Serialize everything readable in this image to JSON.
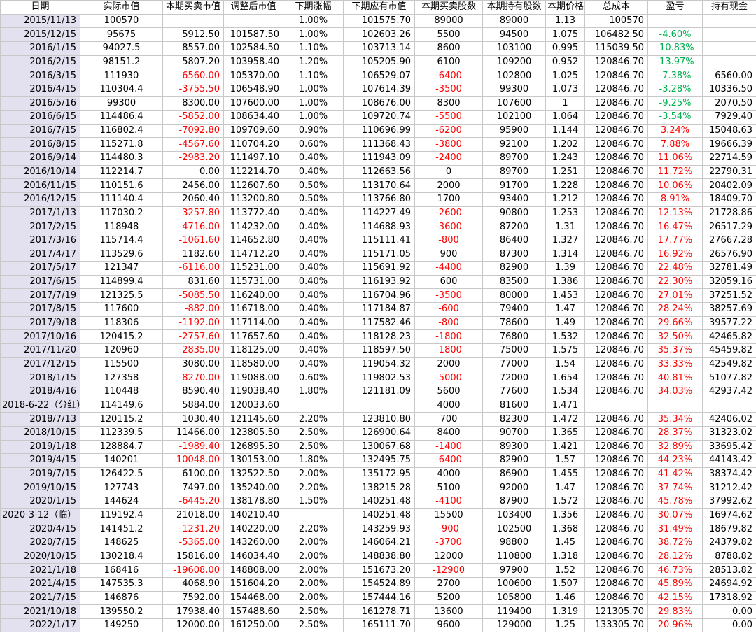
{
  "headers": [
    "日期",
    "实际市值",
    "本期买卖市值",
    "调整后市值",
    "下期涨幅",
    "下期应有市值",
    "本期买卖股数",
    "本期持有股数",
    "本期价格",
    "总成本",
    "盈亏",
    "持有现金"
  ],
  "rows": [
    [
      "2015/11/13",
      "100570",
      "",
      "",
      "1.00%",
      "101575.70",
      "89000",
      "89000",
      "1.13",
      "100570",
      "",
      ""
    ],
    [
      "2015/12/15",
      "95675",
      "5912.50",
      "101587.50",
      "1.00%",
      "102603.26",
      "5500",
      "94500",
      "1.075",
      "106482.50",
      "-4.60%",
      ""
    ],
    [
      "2016/1/15",
      "94027.5",
      "8557.00",
      "102584.50",
      "1.10%",
      "103713.14",
      "8600",
      "103100",
      "0.995",
      "115039.50",
      "-10.83%",
      ""
    ],
    [
      "2016/2/15",
      "98151.2",
      "5807.20",
      "103958.40",
      "1.20%",
      "105205.90",
      "6100",
      "109200",
      "0.952",
      "120846.70",
      "-13.97%",
      ""
    ],
    [
      "2016/3/15",
      "111930",
      "-6560.00",
      "105370.00",
      "1.10%",
      "106529.07",
      "-6400",
      "102800",
      "1.025",
      "120846.70",
      "-7.38%",
      "6560.00"
    ],
    [
      "2016/4/15",
      "110304.4",
      "-3755.50",
      "106548.90",
      "1.00%",
      "107614.39",
      "-3500",
      "99300",
      "1.073",
      "120846.70",
      "-3.28%",
      "10336.50"
    ],
    [
      "2016/5/16",
      "99300",
      "8300.00",
      "107600.00",
      "1.00%",
      "108676.00",
      "8300",
      "107600",
      "1",
      "120846.70",
      "-9.25%",
      "2070.50"
    ],
    [
      "2016/6/15",
      "114486.4",
      "-5852.00",
      "108634.40",
      "1.00%",
      "109720.74",
      "-5500",
      "102100",
      "1.064",
      "120846.70",
      "-3.54%",
      "7929.40"
    ],
    [
      "2016/7/15",
      "116802.4",
      "-7092.80",
      "109709.60",
      "0.90%",
      "110696.99",
      "-6200",
      "95900",
      "1.144",
      "120846.70",
      "3.24%",
      "15048.63"
    ],
    [
      "2016/8/15",
      "115271.8",
      "-4567.60",
      "110704.20",
      "0.60%",
      "111368.43",
      "-3800",
      "92100",
      "1.202",
      "120846.70",
      "7.88%",
      "19666.39"
    ],
    [
      "2016/9/14",
      "114480.3",
      "-2983.20",
      "111497.10",
      "0.40%",
      "111943.09",
      "-2400",
      "89700",
      "1.243",
      "120846.70",
      "11.06%",
      "22714.59"
    ],
    [
      "2016/10/14",
      "112214.7",
      "0.00",
      "112214.70",
      "0.40%",
      "112663.56",
      "0",
      "89700",
      "1.251",
      "120846.70",
      "11.72%",
      "22790.31"
    ],
    [
      "2016/11/15",
      "110151.6",
      "2456.00",
      "112607.60",
      "0.50%",
      "113170.64",
      "2000",
      "91700",
      "1.228",
      "120846.70",
      "10.06%",
      "20402.09"
    ],
    [
      "2016/12/15",
      "111140.4",
      "2060.40",
      "113200.80",
      "0.50%",
      "113766.80",
      "1700",
      "93400",
      "1.212",
      "120846.70",
      "8.91%",
      "18409.70"
    ],
    [
      "2017/1/13",
      "117030.2",
      "-3257.80",
      "113772.40",
      "0.40%",
      "114227.49",
      "-2600",
      "90800",
      "1.253",
      "120846.70",
      "12.13%",
      "21728.86"
    ],
    [
      "2017/2/15",
      "118948",
      "-4716.00",
      "114232.00",
      "0.40%",
      "114688.93",
      "-3600",
      "87200",
      "1.31",
      "120846.70",
      "16.47%",
      "26517.29"
    ],
    [
      "2017/3/16",
      "115714.4",
      "-1061.60",
      "114652.80",
      "0.40%",
      "115111.41",
      "-800",
      "86400",
      "1.327",
      "120846.70",
      "17.77%",
      "27667.28"
    ],
    [
      "2017/4/17",
      "113529.6",
      "1182.60",
      "114712.20",
      "0.40%",
      "115171.05",
      "900",
      "87300",
      "1.314",
      "120846.70",
      "16.92%",
      "26576.90"
    ],
    [
      "2017/5/17",
      "121347",
      "-6116.00",
      "115231.00",
      "0.40%",
      "115691.92",
      "-4400",
      "82900",
      "1.39",
      "120846.70",
      "22.48%",
      "32781.49"
    ],
    [
      "2017/6/15",
      "114899.4",
      "831.60",
      "115731.00",
      "0.40%",
      "116193.92",
      "600",
      "83500",
      "1.386",
      "120846.70",
      "22.30%",
      "32059.16"
    ],
    [
      "2017/7/19",
      "121325.5",
      "-5085.50",
      "116240.00",
      "0.40%",
      "116704.96",
      "-3500",
      "80000",
      "1.453",
      "120846.70",
      "27.01%",
      "37251.52"
    ],
    [
      "2017/8/15",
      "117600",
      "-882.00",
      "116718.00",
      "0.40%",
      "117184.87",
      "-600",
      "79400",
      "1.47",
      "120846.70",
      "28.24%",
      "38257.69"
    ],
    [
      "2017/9/18",
      "118306",
      "-1192.00",
      "117114.00",
      "0.40%",
      "117582.46",
      "-800",
      "78600",
      "1.49",
      "120846.70",
      "29.66%",
      "39577.22"
    ],
    [
      "2017/10/16",
      "120415.2",
      "-2757.60",
      "117657.60",
      "0.40%",
      "118128.23",
      "-1800",
      "76800",
      "1.532",
      "120846.70",
      "32.50%",
      "42465.82"
    ],
    [
      "2017/11/20",
      "120960",
      "-2835.00",
      "118125.00",
      "0.40%",
      "118597.50",
      "-1800",
      "75000",
      "1.575",
      "120846.70",
      "35.37%",
      "45459.82"
    ],
    [
      "2017/12/15",
      "115500",
      "3080.00",
      "118580.00",
      "0.40%",
      "119054.32",
      "2000",
      "77000",
      "1.54",
      "120846.70",
      "33.33%",
      "42549.82"
    ],
    [
      "2018/1/15",
      "127358",
      "-8270.00",
      "119088.00",
      "0.60%",
      "119802.53",
      "-5000",
      "72000",
      "1.654",
      "120846.70",
      "40.81%",
      "51077.82"
    ],
    [
      "2018/4/16",
      "110448",
      "8590.40",
      "119038.40",
      "1.80%",
      "121181.09",
      "5600",
      "77600",
      "1.534",
      "120846.70",
      "34.03%",
      "42937.42"
    ],
    [
      "2018-6-22（分红）",
      "114149.6",
      "5884.00",
      "120033.60",
      "",
      "",
      "4000",
      "81600",
      "1.471",
      "",
      "",
      ""
    ],
    [
      "2018/7/13",
      "120115.2",
      "1030.40",
      "121145.60",
      "2.20%",
      "123810.80",
      "700",
      "82300",
      "1.472",
      "120846.70",
      "35.34%",
      "42406.02"
    ],
    [
      "2018/10/15",
      "112339.5",
      "11466.00",
      "123805.50",
      "2.50%",
      "126900.64",
      "8400",
      "90700",
      "1.365",
      "120846.70",
      "28.37%",
      "31323.02"
    ],
    [
      "2019/1/18",
      "128884.7",
      "-1989.40",
      "126895.30",
      "2.50%",
      "130067.68",
      "-1400",
      "89300",
      "1.421",
      "120846.70",
      "32.89%",
      "33695.42"
    ],
    [
      "2019/4/15",
      "140201",
      "-10048.00",
      "130153.00",
      "1.80%",
      "132495.75",
      "-6400",
      "82900",
      "1.57",
      "120846.70",
      "44.23%",
      "44143.42"
    ],
    [
      "2019/7/15",
      "126422.5",
      "6100.00",
      "132522.50",
      "2.00%",
      "135172.95",
      "4000",
      "86900",
      "1.455",
      "120846.70",
      "41.42%",
      "38374.42"
    ],
    [
      "2019/10/15",
      "127743",
      "7497.00",
      "135240.00",
      "2.20%",
      "138215.28",
      "5100",
      "92000",
      "1.47",
      "120846.70",
      "37.74%",
      "31212.42"
    ],
    [
      "2020/1/15",
      "144624",
      "-6445.20",
      "138178.80",
      "1.50%",
      "140251.48",
      "-4100",
      "87900",
      "1.572",
      "120846.70",
      "45.78%",
      "37992.62"
    ],
    [
      "2020-3-12（临）",
      "119192.4",
      "21018.00",
      "140210.40",
      "",
      "140251.48",
      "15500",
      "103400",
      "1.356",
      "120846.70",
      "30.07%",
      "16974.62"
    ],
    [
      "2020/4/15",
      "141451.2",
      "-1231.20",
      "140220.00",
      "2.20%",
      "143259.93",
      "-900",
      "102500",
      "1.368",
      "120846.70",
      "31.49%",
      "18679.82"
    ],
    [
      "2020/7/15",
      "148625",
      "-5365.00",
      "143260.00",
      "2.00%",
      "146064.21",
      "-3700",
      "98800",
      "1.45",
      "120846.70",
      "38.72%",
      "24379.82"
    ],
    [
      "2020/10/15",
      "130218.4",
      "15816.00",
      "146034.40",
      "2.00%",
      "148838.80",
      "12000",
      "110800",
      "1.318",
      "120846.70",
      "28.12%",
      "8788.82"
    ],
    [
      "2021/1/18",
      "168416",
      "-19608.00",
      "148808.00",
      "2.00%",
      "151673.20",
      "-12900",
      "97900",
      "1.52",
      "120846.70",
      "46.73%",
      "28513.82"
    ],
    [
      "2021/4/15",
      "147535.3",
      "4068.90",
      "151604.20",
      "2.00%",
      "154524.89",
      "2700",
      "100600",
      "1.507",
      "120846.70",
      "45.89%",
      "24694.92"
    ],
    [
      "2021/7/15",
      "146876",
      "7592.00",
      "154468.00",
      "2.00%",
      "157444.16",
      "5200",
      "105800",
      "1.46",
      "120846.70",
      "42.15%",
      "17318.92"
    ],
    [
      "2021/10/18",
      "139550.2",
      "17938.40",
      "157488.60",
      "2.50%",
      "161278.71",
      "13600",
      "119400",
      "1.319",
      "121305.70",
      "29.83%",
      "0.00"
    ],
    [
      "2022/1/17",
      "149250",
      "12000.00",
      "161250.00",
      "2.50%",
      "165111.70",
      "9600",
      "129000",
      "1.25",
      "133305.70",
      "20.96%",
      "0.00"
    ]
  ]
}
